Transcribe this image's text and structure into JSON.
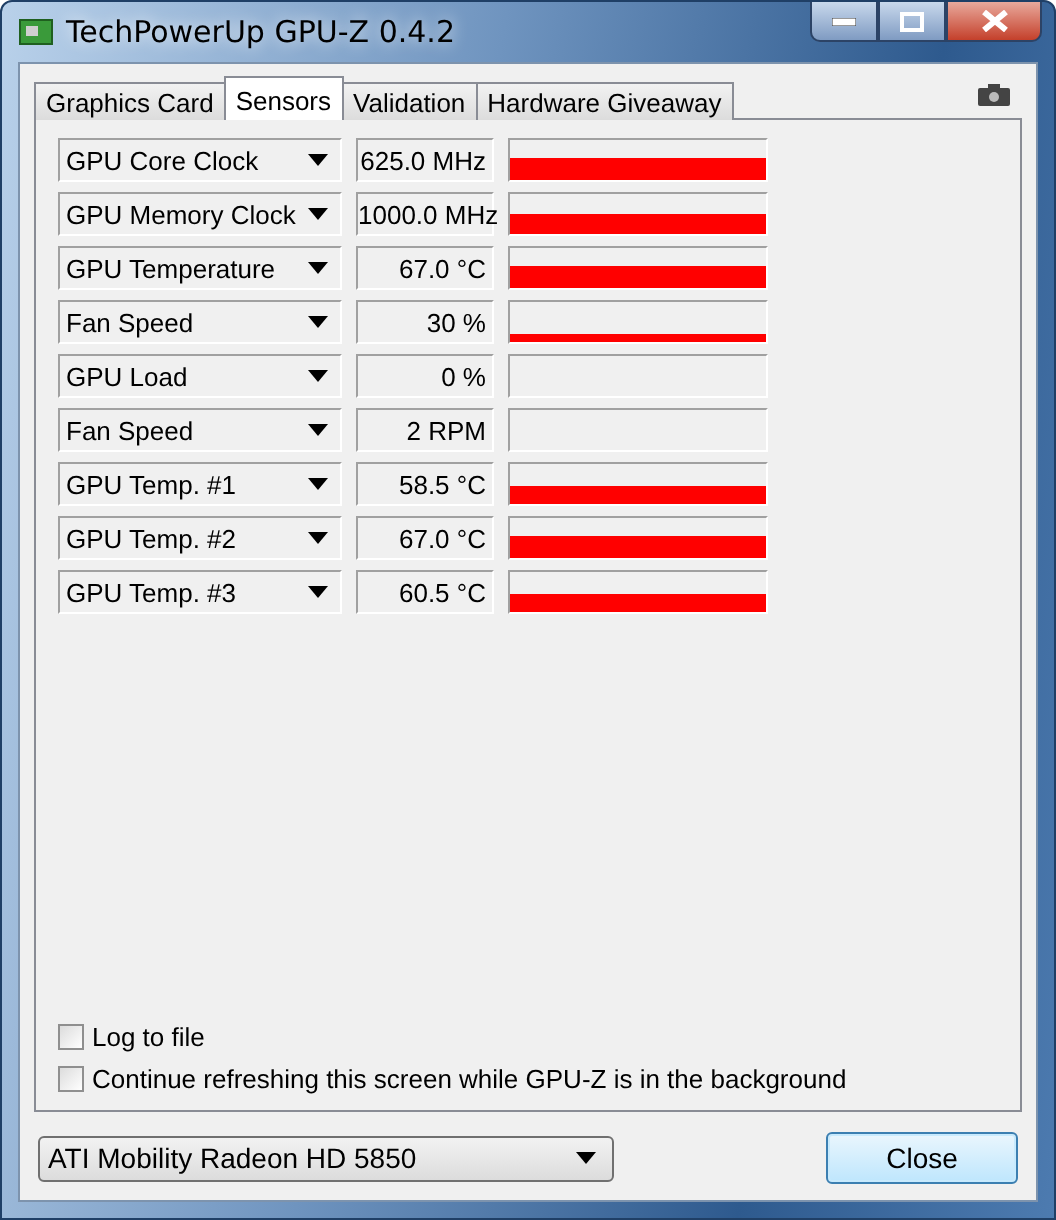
{
  "window": {
    "title": "TechPowerUp GPU-Z 0.4.2"
  },
  "tabs": [
    {
      "label": "Graphics Card",
      "selected": false
    },
    {
      "label": "Sensors",
      "selected": true
    },
    {
      "label": "Validation",
      "selected": false
    },
    {
      "label": "Hardware Giveaway",
      "selected": false
    }
  ],
  "sensors": [
    {
      "name": "GPU Core Clock",
      "reading": "625.0 MHz"
    },
    {
      "name": "GPU Memory Clock",
      "reading": "1000.0 MHz"
    },
    {
      "name": "GPU Temperature",
      "reading": "67.0 °C"
    },
    {
      "name": "Fan Speed",
      "reading": "30 %"
    },
    {
      "name": "GPU Load",
      "reading": "0 %"
    },
    {
      "name": "Fan Speed",
      "reading": "2 RPM"
    },
    {
      "name": "GPU Temp. #1",
      "reading": "58.5 °C"
    },
    {
      "name": "GPU Temp. #2",
      "reading": "67.0 °C"
    },
    {
      "name": "GPU Temp. #3",
      "reading": "60.5 °C"
    }
  ],
  "options": [
    {
      "label": "Log to file",
      "checked": false
    },
    {
      "label": "Continue refreshing this screen while GPU-Z is in the background",
      "checked": false
    }
  ],
  "gpu_select": {
    "value": "ATI Mobility Radeon HD 5850"
  },
  "buttons": [
    "Close"
  ]
}
